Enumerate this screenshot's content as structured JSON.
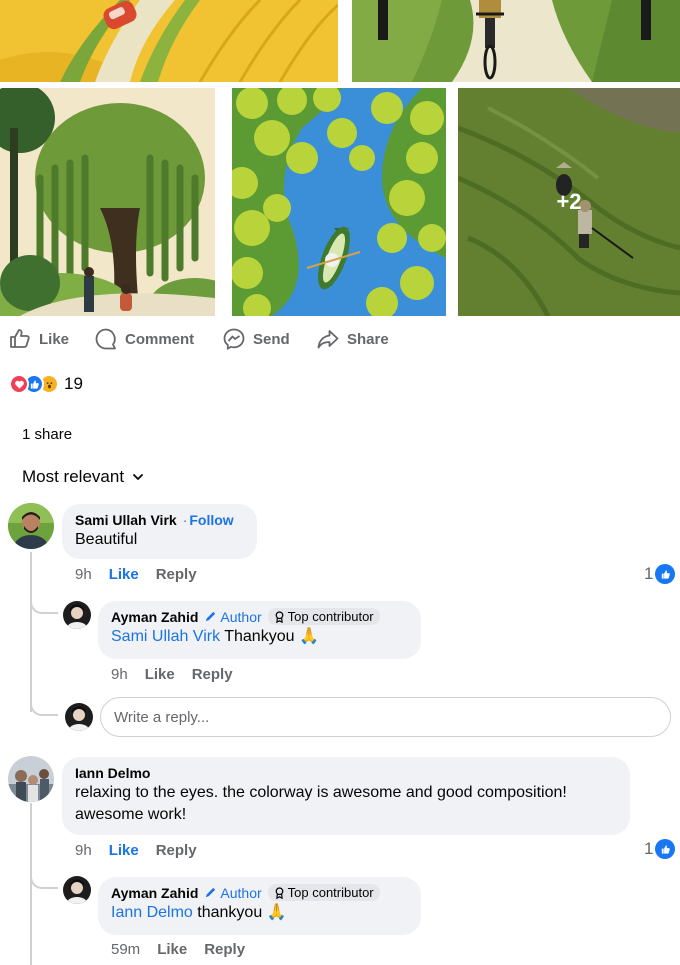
{
  "gallery": {
    "more_count": "+2"
  },
  "actions": {
    "like": "Like",
    "comment": "Comment",
    "send": "Send",
    "share": "Share"
  },
  "reactions": {
    "count": "19"
  },
  "shares": {
    "label": "1 share"
  },
  "sort": {
    "label": "Most relevant"
  },
  "comments": [
    {
      "author": "Sami Ullah Virk",
      "follow": "Follow",
      "separator": "·",
      "text": "Beautiful",
      "time": "9h",
      "like": "Like",
      "reply": "Reply",
      "like_count": "1",
      "replies": [
        {
          "author": "Ayman Zahid",
          "author_badge": "Author",
          "top_badge": "Top contributor",
          "mention": "Sami Ullah Virk",
          "text": "Thankyou 🙏",
          "time": "9h",
          "like": "Like",
          "reply": "Reply"
        }
      ]
    },
    {
      "author": "Iann Delmo",
      "text": "relaxing to the eyes. the colorway is awesome and good composition! awesome work!",
      "time": "9h",
      "like": "Like",
      "reply": "Reply",
      "like_count": "1",
      "replies": [
        {
          "author": "Ayman Zahid",
          "author_badge": "Author",
          "top_badge": "Top contributor",
          "mention": "Iann Delmo",
          "text": "thankyou 🙏",
          "time": "59m",
          "like": "Like",
          "reply": "Reply"
        }
      ]
    }
  ],
  "reply_box": {
    "placeholder": "Write a reply..."
  },
  "colors": {
    "accent": "#1b74e4",
    "muted": "#65676b",
    "bubble": "#f0f2f5"
  }
}
